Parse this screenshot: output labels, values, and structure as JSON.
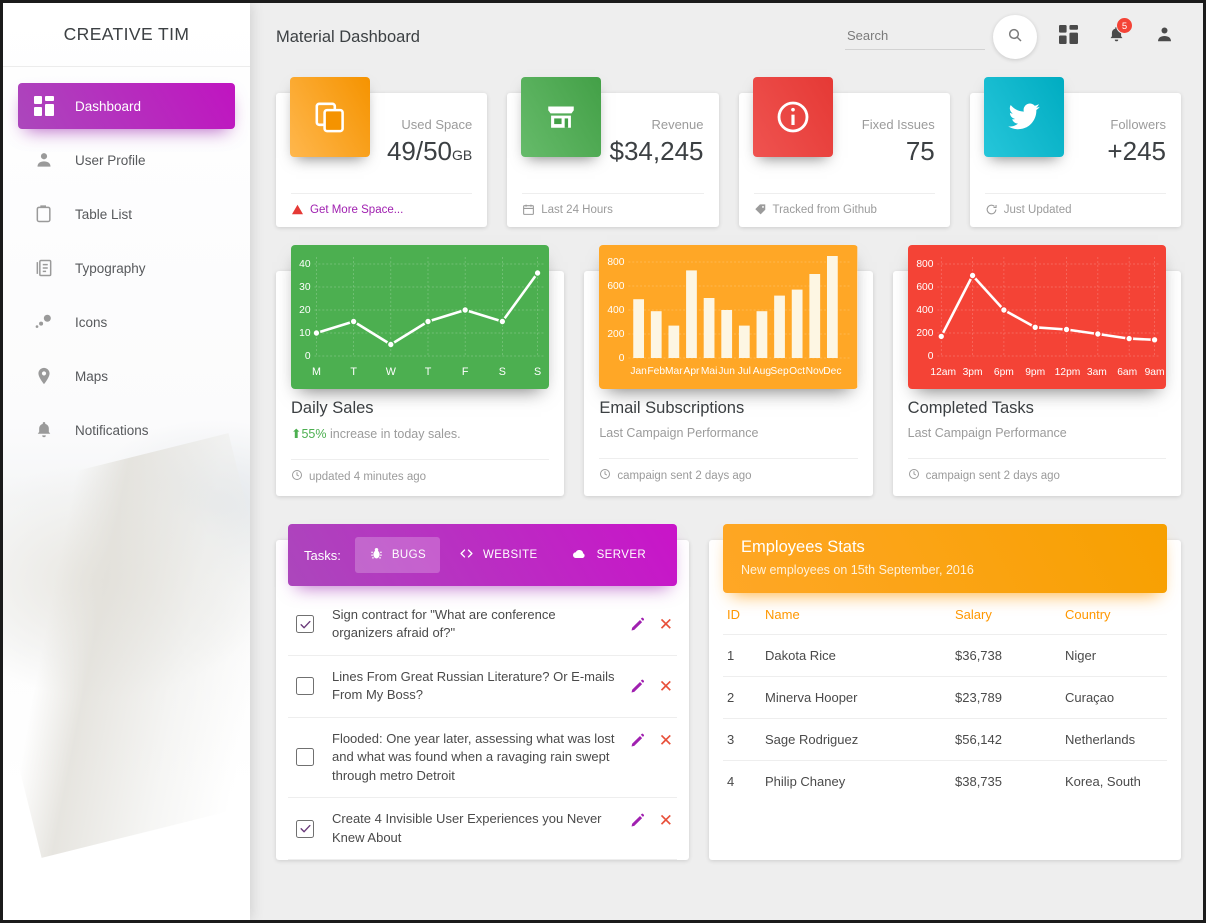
{
  "sidebar": {
    "brand": "CREATIVE TIM",
    "items": [
      {
        "label": "Dashboard",
        "icon": "dashboard-icon",
        "active": true
      },
      {
        "label": "User Profile",
        "icon": "person-icon",
        "active": false
      },
      {
        "label": "Table List",
        "icon": "clipboard-icon",
        "active": false
      },
      {
        "label": "Typography",
        "icon": "typography-icon",
        "active": false
      },
      {
        "label": "Icons",
        "icon": "bubble-icon",
        "active": false
      },
      {
        "label": "Maps",
        "icon": "map-pin-icon",
        "active": false
      },
      {
        "label": "Notifications",
        "icon": "bell-icon",
        "active": false
      }
    ]
  },
  "header": {
    "title": "Material Dashboard",
    "search": {
      "value": "",
      "placeholder": "Search"
    },
    "search_button_icon": "search-icon",
    "grid_icon": "dashboard-grid-icon",
    "bell_icon": "bell-icon",
    "notification_count": "5",
    "person_icon": "person-icon"
  },
  "stats": [
    {
      "category": "Used Space",
      "value": "49/50",
      "unit": "GB",
      "icon": "copy-icon",
      "color": "#ffa726",
      "footer": "Get More Space...",
      "footer_icon": "warning-icon",
      "footer_is_link": true
    },
    {
      "category": "Revenue",
      "value": "$34,245",
      "unit": "",
      "icon": "store-icon",
      "color": "#4caf50",
      "footer": "Last 24 Hours",
      "footer_icon": "calendar-icon",
      "footer_is_link": false
    },
    {
      "category": "Fixed Issues",
      "value": "75",
      "unit": "",
      "icon": "info-icon",
      "color": "#f44336",
      "footer": "Tracked from Github",
      "footer_icon": "tag-icon",
      "footer_is_link": false
    },
    {
      "category": "Followers",
      "value": "+245",
      "unit": "",
      "icon": "twitter-icon",
      "color": "#00bcd4",
      "footer": "Just Updated",
      "footer_icon": "refresh-icon",
      "footer_is_link": false
    }
  ],
  "chart_cards": [
    {
      "title": "Daily Sales",
      "subtitle_prefix": "55%",
      "subtitle": " increase in today sales.",
      "footer": "updated 4 minutes ago",
      "footer_icon": "clock-icon",
      "color": "#4caf50"
    },
    {
      "title": "Email Subscriptions",
      "subtitle_prefix": "",
      "subtitle": "Last Campaign Performance",
      "footer": "campaign sent 2 days ago",
      "footer_icon": "clock-icon",
      "color": "#ffa726"
    },
    {
      "title": "Completed Tasks",
      "subtitle_prefix": "",
      "subtitle": "Last Campaign Performance",
      "footer": "campaign sent 2 days ago",
      "footer_icon": "clock-icon",
      "color": "#f44336"
    }
  ],
  "chart_data": [
    {
      "type": "line",
      "title": "Daily Sales",
      "categories": [
        "M",
        "T",
        "W",
        "T",
        "F",
        "S",
        "S"
      ],
      "values": [
        10,
        15,
        5,
        15,
        20,
        15,
        36
      ],
      "yticks": [
        0,
        10,
        20,
        30,
        40
      ],
      "ylim": [
        0,
        44
      ],
      "xlabel": "",
      "ylabel": "",
      "grid": true,
      "legend": "none",
      "plot_bg": "#4caf50",
      "line_color": "#ffffff"
    },
    {
      "type": "bar",
      "title": "Email Subscriptions",
      "categories": [
        "Jan",
        "Feb",
        "Mar",
        "Apr",
        "Mai",
        "Jun",
        "Jul",
        "Aug",
        "Sep",
        "Oct",
        "Nov",
        "Dec"
      ],
      "values": [
        490,
        390,
        270,
        730,
        500,
        400,
        270,
        390,
        520,
        570,
        700,
        850
      ],
      "yticks": [
        0,
        200,
        400,
        600,
        800
      ],
      "ylim": [
        0,
        900
      ],
      "xlabel": "",
      "ylabel": "",
      "grid": true,
      "legend": "none",
      "plot_bg": "#ffa726",
      "bar_color": "#fff8e6"
    },
    {
      "type": "line",
      "title": "Completed Tasks",
      "categories": [
        "12am",
        "3pm",
        "6pm",
        "9pm",
        "12pm",
        "3am",
        "6am",
        "9am"
      ],
      "values": [
        170,
        700,
        400,
        250,
        230,
        190,
        150,
        140
      ],
      "yticks": [
        0,
        200,
        400,
        600,
        800
      ],
      "ylim": [
        0,
        880
      ],
      "xlabel": "",
      "ylabel": "",
      "grid": true,
      "legend": "none",
      "plot_bg": "#f44336",
      "line_color": "#ffffff"
    }
  ],
  "tasks": {
    "label": "Tasks:",
    "tabs": [
      {
        "label": "BUGS",
        "icon": "bug-icon",
        "active": true
      },
      {
        "label": "WEBSITE",
        "icon": "code-icon",
        "active": false
      },
      {
        "label": "SERVER",
        "icon": "cloud-icon",
        "active": false
      }
    ],
    "items": [
      {
        "checked": true,
        "text": "Sign contract for \"What are conference organizers afraid of?\""
      },
      {
        "checked": false,
        "text": "Lines From Great Russian Literature? Or E-mails From My Boss?"
      },
      {
        "checked": false,
        "text": "Flooded: One year later, assessing what was lost and what was found when a ravaging rain swept through metro Detroit"
      },
      {
        "checked": true,
        "text": "Create 4 Invisible User Experiences you Never Knew About"
      }
    ],
    "edit_icon": "pencil-icon",
    "delete_icon": "close-icon"
  },
  "employees": {
    "title": "Employees Stats",
    "subtitle": "New employees on 15th September, 2016",
    "columns": [
      "ID",
      "Name",
      "Salary",
      "Country"
    ],
    "rows": [
      {
        "id": "1",
        "name": "Dakota Rice",
        "salary": "$36,738",
        "country": "Niger"
      },
      {
        "id": "2",
        "name": "Minerva Hooper",
        "salary": "$23,789",
        "country": "Curaçao"
      },
      {
        "id": "3",
        "name": "Sage Rodriguez",
        "salary": "$56,142",
        "country": "Netherlands"
      },
      {
        "id": "4",
        "name": "Philip Chaney",
        "salary": "$38,735",
        "country": "Korea, South"
      }
    ]
  },
  "theme": {
    "purple": "#ab47bc",
    "orange": "#ffa726",
    "green": "#4caf50",
    "red": "#f44336",
    "cyan": "#00bcd4",
    "page_bg": "#eeeeee"
  }
}
